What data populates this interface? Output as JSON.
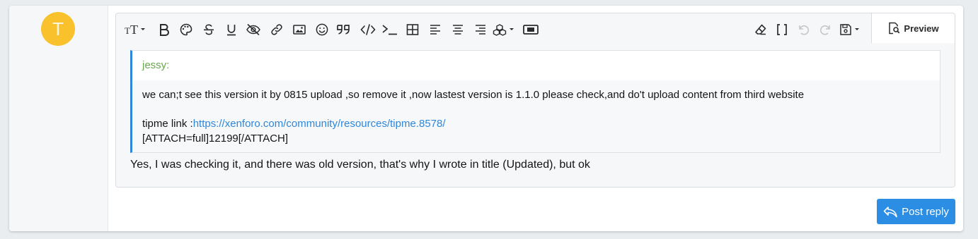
{
  "user": {
    "avatar_letter": "T",
    "avatar_color": "#f9c22c"
  },
  "toolbar": {
    "buttons": [
      "text-size-icon",
      "bold-icon",
      "palette-icon",
      "strikethrough-icon",
      "underline-icon",
      "hide-icon",
      "link-icon",
      "image-icon",
      "smilie-icon",
      "quote-icon",
      "code-icon",
      "inline-code-icon",
      "table-icon",
      "align-left-icon",
      "align-center-icon",
      "align-right-icon",
      "insert-more-icon",
      "media-icon",
      "eraser-icon",
      "bbcode-toggle-icon",
      "undo-icon",
      "redo-icon",
      "drafts-icon"
    ],
    "preview_label": "Preview"
  },
  "quote": {
    "author": "jessy:",
    "line1": "we can;t see this version it by 0815 upload ,so remove it ,now lastest version is 1.1.0 please check,and do't upload content from third website",
    "link_prefix": "tipme link :",
    "link_text": "https://xenforo.com/community/resources/tipme.8578/",
    "attach_line": "[ATTACH=full]12199[/ATTACH]"
  },
  "reply_text": "Yes, I was checking it, and there was old version, that's why I wrote in title (Updated), but ok",
  "post_reply_label": "Post reply",
  "colors": {
    "accent": "#2b8de3",
    "quote_author": "#6aa84f",
    "link": "#2f87d9"
  }
}
